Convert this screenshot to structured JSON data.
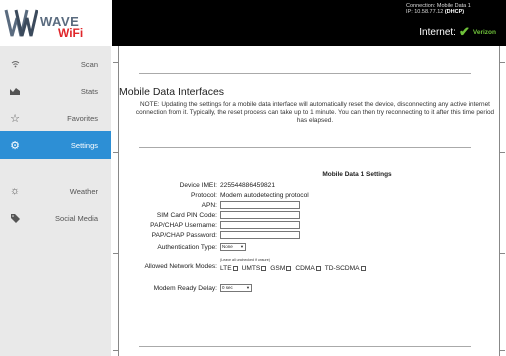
{
  "header": {
    "logo": {
      "wave": "WAVE",
      "wifi": "WiFi"
    },
    "connection_line": "Connection: Mobile Data 1",
    "ip_prefix": "IP: 10.58.77.12 ",
    "ip_mode": "(DHCP)",
    "internet_label": "Internet:",
    "carrier": "Verizon",
    "check_icon": "check-icon"
  },
  "sidebar": {
    "items": [
      {
        "label": "Scan",
        "icon": "wifi-icon",
        "active": false
      },
      {
        "label": "Stats",
        "icon": "chart-icon",
        "active": false
      },
      {
        "label": "Favorites",
        "icon": "star-icon",
        "active": false
      },
      {
        "label": "Settings",
        "icon": "gears-icon",
        "active": true
      },
      {
        "label": "Weather",
        "icon": "sun-icon",
        "active": false
      },
      {
        "label": "Social Media",
        "icon": "tag-icon",
        "active": false
      }
    ],
    "active_color": "#2d8fd5"
  },
  "main": {
    "title": "Mobile Data Interfaces",
    "note": "NOTE: Updating the settings for a mobile data interface will automatically reset the device, disconnecting any active internet connection from it. Typically, the reset process can take up to 1 minute. You can then try reconnecting to it after this time period has elapsed.",
    "section_title": "Mobile Data 1 Settings",
    "fields": {
      "imei_label": "Device IMEI:",
      "imei_value": "225544886459821",
      "protocol_label": "Protocol:",
      "protocol_value": "Modem autodetecting protocol",
      "apn_label": "APN:",
      "apn_value": "",
      "pin_label": "SIM Card PIN Code:",
      "pin_value": "",
      "pap_user_label": "PAP/CHAP Username:",
      "pap_user_value": "",
      "pap_pass_label": "PAP/CHAP Password:",
      "pap_pass_value": "",
      "auth_label": "Authentication Type:",
      "auth_value": "None",
      "modes_label": "Allowed Network Modes:",
      "modes_note": "(Leave all unchecked if unsure)",
      "modes": [
        "LTE",
        "UMTS",
        "GSM",
        "CDMA",
        "TD-SCDMA"
      ],
      "delay_label": "Modem Ready Delay:",
      "delay_value": "0 sec"
    }
  }
}
